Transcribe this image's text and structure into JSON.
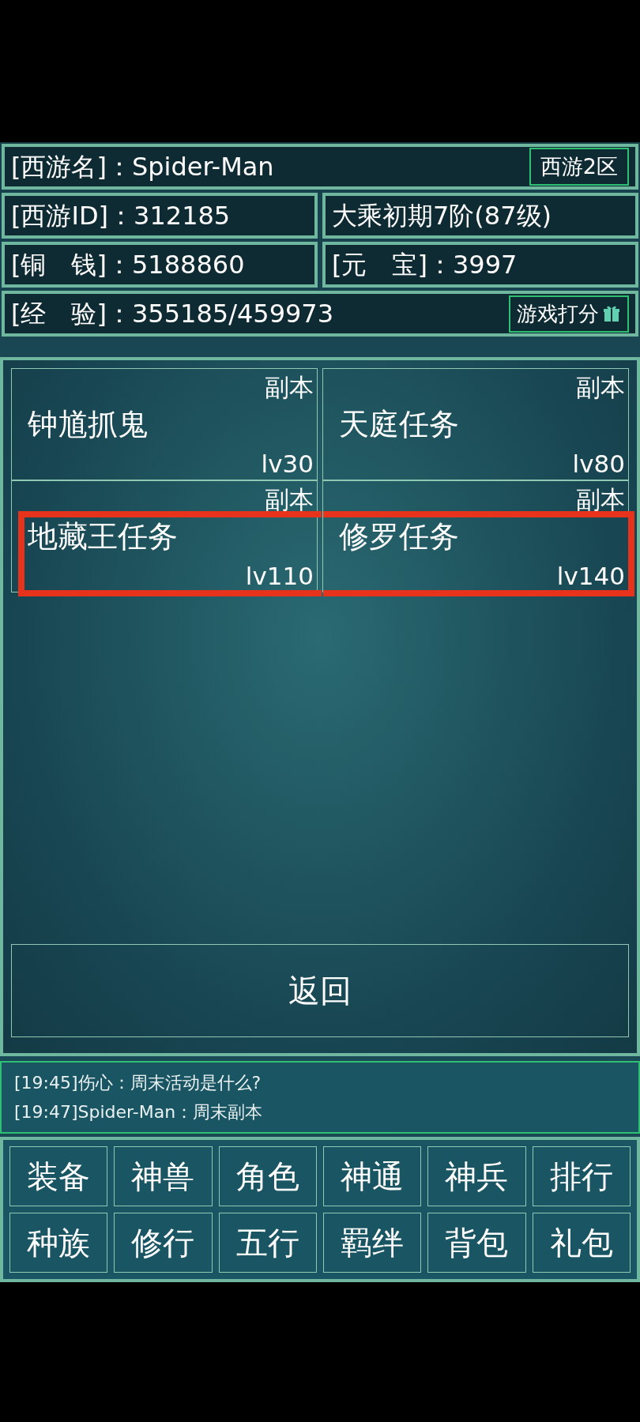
{
  "profile": {
    "name_label": "[西游名]：Spider-Man",
    "server": "西游2区",
    "id_label": "[西游ID]：312185",
    "realm": "大乘初期7阶(87级)",
    "coins_label": "[铜　钱]：5188860",
    "ingots_label": "[元　宝]：3997",
    "exp_label": "[经　验]：355185/459973",
    "rate_button": "游戏打分"
  },
  "dungeons": [
    {
      "title": "钟馗抓鬼",
      "tag": "副本",
      "level": "lv30",
      "highlighted": false
    },
    {
      "title": "天庭任务",
      "tag": "副本",
      "level": "lv80",
      "highlighted": false
    },
    {
      "title": "地藏王任务",
      "tag": "副本",
      "level": "lv110",
      "highlighted": true
    },
    {
      "title": "修罗任务",
      "tag": "副本",
      "level": "lv140",
      "highlighted": true
    }
  ],
  "back_button": "返回",
  "chat": [
    "[19:45]伤心：周末活动是什么?",
    "[19:47]Spider-Man：周末副本"
  ],
  "menu": [
    "装备",
    "神兽",
    "角色",
    "神通",
    "神兵",
    "排行",
    "种族",
    "修行",
    "五行",
    "羁绊",
    "背包",
    "礼包"
  ]
}
